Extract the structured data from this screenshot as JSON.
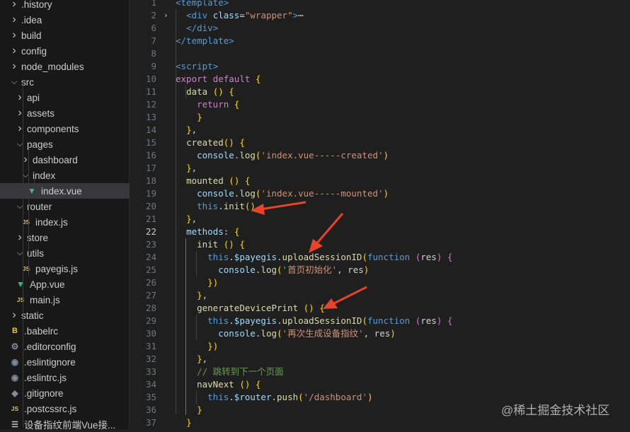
{
  "explorer": {
    "items": [
      {
        "label": ".history",
        "icon": "chevron-right",
        "kind": "folder"
      },
      {
        "label": ".idea",
        "icon": "chevron-right",
        "kind": "folder"
      },
      {
        "label": "build",
        "icon": "chevron-right",
        "kind": "folder"
      },
      {
        "label": "config",
        "icon": "chevron-right",
        "kind": "folder"
      },
      {
        "label": "node_modules",
        "icon": "chevron-right",
        "kind": "folder"
      },
      {
        "label": "src",
        "icon": "chevron-down",
        "kind": "folder"
      },
      {
        "label": "api",
        "icon": "chevron-right",
        "kind": "folder"
      },
      {
        "label": "assets",
        "icon": "chevron-right",
        "kind": "folder"
      },
      {
        "label": "components",
        "icon": "chevron-right",
        "kind": "folder"
      },
      {
        "label": "pages",
        "icon": "chevron-down",
        "kind": "folder"
      },
      {
        "label": "dashboard",
        "icon": "chevron-right",
        "kind": "folder"
      },
      {
        "label": "index",
        "icon": "chevron-down",
        "kind": "folder"
      },
      {
        "label": "index.vue",
        "icon": "vue-icon",
        "kind": "file",
        "selected": true
      },
      {
        "label": "router",
        "icon": "chevron-down",
        "kind": "folder"
      },
      {
        "label": "index.js",
        "icon": "js-icon",
        "kind": "file"
      },
      {
        "label": "store",
        "icon": "chevron-right",
        "kind": "folder"
      },
      {
        "label": "utils",
        "icon": "chevron-down",
        "kind": "folder"
      },
      {
        "label": "payegis.js",
        "icon": "js-icon",
        "kind": "file"
      },
      {
        "label": "App.vue",
        "icon": "vue-icon",
        "kind": "file"
      },
      {
        "label": "main.js",
        "icon": "js-icon",
        "kind": "file"
      },
      {
        "label": "static",
        "icon": "chevron-right",
        "kind": "folder"
      },
      {
        "label": ".babelrc",
        "icon": "babel-icon",
        "kind": "file"
      },
      {
        "label": ".editorconfig",
        "icon": "gear-icon",
        "kind": "file"
      },
      {
        "label": ".eslintignore",
        "icon": "eslint-icon",
        "kind": "file"
      },
      {
        "label": ".eslintrc.js",
        "icon": "eslint-icon",
        "kind": "file"
      },
      {
        "label": ".gitignore",
        "icon": "git-icon",
        "kind": "file"
      },
      {
        "label": ".postcssrc.js",
        "icon": "js-icon",
        "kind": "file"
      },
      {
        "label": "设备指纹前端Vue接...",
        "icon": "doc-icon",
        "kind": "file"
      }
    ]
  },
  "editor": {
    "lines": [
      {
        "n": "1",
        "text": "<template>"
      },
      {
        "n": "2",
        "text": "  <div class=\"wrapper\">⋯"
      },
      {
        "n": "6",
        "text": "  </div>"
      },
      {
        "n": "7",
        "text": "</template>"
      },
      {
        "n": "8",
        "text": ""
      },
      {
        "n": "9",
        "text": "<script>"
      },
      {
        "n": "10",
        "text": "export default {"
      },
      {
        "n": "11",
        "text": "  data () {"
      },
      {
        "n": "12",
        "text": "    return {"
      },
      {
        "n": "13",
        "text": "    }"
      },
      {
        "n": "14",
        "text": "  },"
      },
      {
        "n": "15",
        "text": "  created() {"
      },
      {
        "n": "16",
        "text": "    console.log('index.vue-----created')"
      },
      {
        "n": "17",
        "text": "  },"
      },
      {
        "n": "18",
        "text": "  mounted () {"
      },
      {
        "n": "19",
        "text": "    console.log('index.vue-----mounted')"
      },
      {
        "n": "20",
        "text": "    this.init()"
      },
      {
        "n": "21",
        "text": "  },"
      },
      {
        "n": "22",
        "text": "  methods: {"
      },
      {
        "n": "23",
        "text": "    init () {"
      },
      {
        "n": "24",
        "text": "      this.$payegis.uploadSessionID(function (res) {"
      },
      {
        "n": "25",
        "text": "        console.log('首页初始化', res)"
      },
      {
        "n": "26",
        "text": "      })"
      },
      {
        "n": "27",
        "text": "    },"
      },
      {
        "n": "28",
        "text": "    generateDevicePrint () {"
      },
      {
        "n": "29",
        "text": "      this.$payegis.uploadSessionID(function (res) {"
      },
      {
        "n": "30",
        "text": "        console.log('再次生成设备指纹', res)"
      },
      {
        "n": "31",
        "text": "      })"
      },
      {
        "n": "32",
        "text": "    },"
      },
      {
        "n": "33",
        "text": "    // 跳转到下一个页面"
      },
      {
        "n": "34",
        "text": "    navNext () {"
      },
      {
        "n": "35",
        "text": "      this.$router.push('/dashboard')"
      },
      {
        "n": "36",
        "text": "    }"
      },
      {
        "n": "37",
        "text": "  }"
      }
    ],
    "active_line": "22"
  },
  "watermark": {
    "text": "@稀土掘金技术社区"
  },
  "colors": {
    "arrow": "#e8442a",
    "background": "#1f1f1f",
    "sidebar": "#181818"
  }
}
